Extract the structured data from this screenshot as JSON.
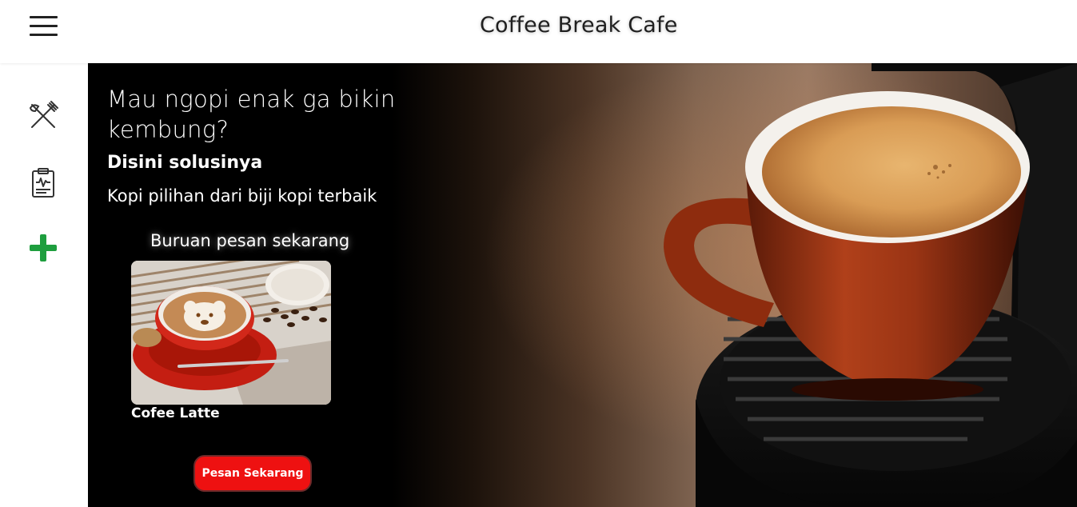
{
  "header": {
    "title": "Coffee Break Cafe",
    "menu_icon": "hamburger-menu-icon"
  },
  "sidebar": {
    "items": [
      {
        "icon": "utensils-icon"
      },
      {
        "icon": "clipboard-report-icon"
      },
      {
        "icon": "plus-icon",
        "color": "#1e9e3e"
      }
    ]
  },
  "hero": {
    "headline": "Mau ngopi enak ga bikin kembung?",
    "subheading": "Disini solusinya",
    "tagline": "Kopi pilihan dari biji kopi terbaik",
    "cta_heading": "Buruan pesan sekarang",
    "product": {
      "name": "Cofee Latte"
    },
    "order_button": "Pesan Sekarang"
  },
  "colors": {
    "accent": "#ee1111",
    "plus": "#1e9e3e",
    "hero_bg": "#000000"
  }
}
